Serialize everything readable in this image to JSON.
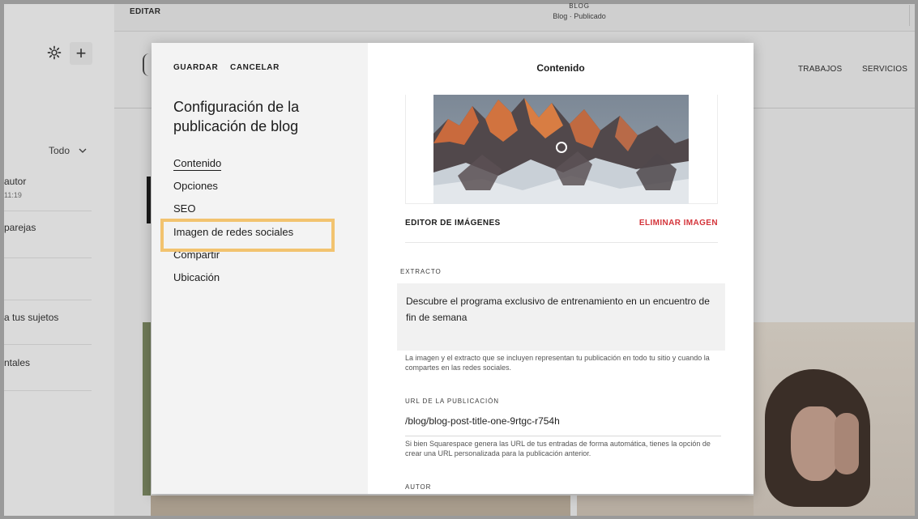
{
  "background": {
    "editor_label": "EDITAR",
    "page_title": "BLOG",
    "page_status": "Blog · Publicado",
    "filter_label": "Todo",
    "site_nav": [
      "TRABAJOS",
      "SERVICIOS"
    ],
    "list_items": [
      {
        "title": "autor",
        "time": "11:19"
      },
      {
        "title": "parejas"
      },
      {
        "title": "a tus sujetos"
      },
      {
        "title": "ntales"
      }
    ]
  },
  "modal": {
    "save_label": "GUARDAR",
    "cancel_label": "CANCELAR",
    "title": "Configuración de la publicación de blog",
    "nav": [
      "Contenido",
      "Opciones",
      "SEO",
      "Imagen de redes sociales",
      "Compartir",
      "Ubicación"
    ],
    "active_nav": "Contenido",
    "highlighted_nav": "Imagen de redes sociales",
    "highlight_color": "#f2c36f",
    "content": {
      "header": "Contenido",
      "image_editor_label": "EDITOR DE IMÁGENES",
      "remove_image_label": "ELIMINAR IMAGEN",
      "remove_color": "#d4343a",
      "excerpt_label": "EXTRACTO",
      "excerpt_value": "Descubre el programa exclusivo de entrenamiento en un encuentro de fin de semana",
      "excerpt_help": "La imagen y el extracto que se incluyen representan tu publicación en todo tu sitio y cuando la compartes en las redes sociales.",
      "url_label": "URL DE LA PUBLICACIÓN",
      "url_value": "/blog/blog-post-title-one-9rtgc-r754h",
      "url_help": "Si bien Squarespace genera las URL de tus entradas de forma automática, tienes la opción de crear una URL personalizada para la publicación anterior.",
      "author_label": "AUTOR"
    }
  }
}
